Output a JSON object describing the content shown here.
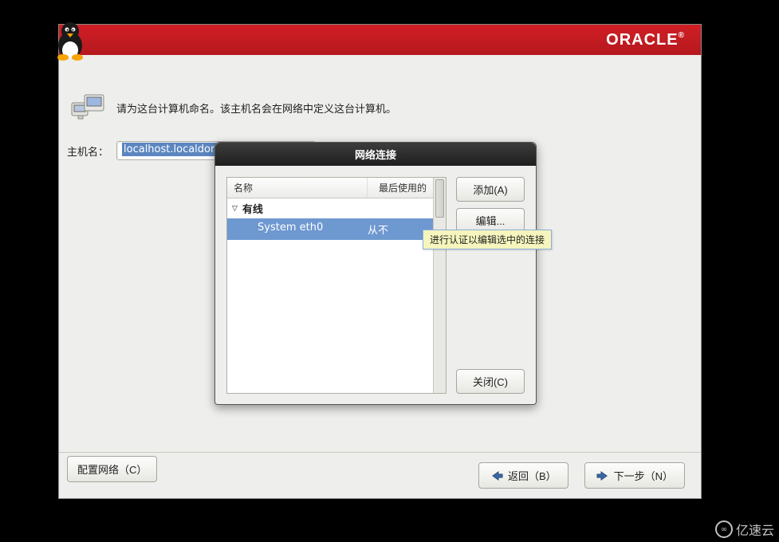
{
  "header": {
    "brand": "ORACLE"
  },
  "instruction": "请为这台计算机命名。该主机名会在网络中定义这台计算机。",
  "hostname": {
    "label": "主机名：",
    "value": "localhost.localdomain"
  },
  "configure_network_label": "配置网络（C）",
  "footer": {
    "back": "返回（B）",
    "next": "下一步（N）"
  },
  "dialog": {
    "title": "网络连接",
    "columns": {
      "name": "名称",
      "last": "最后使用的"
    },
    "group": "有线",
    "row": {
      "name": "System eth0",
      "last": "从不"
    },
    "buttons": {
      "add": "添加(A)",
      "edit": "编辑...",
      "close": "关闭(C)"
    }
  },
  "tooltip": "进行认证以编辑选中的连接",
  "watermark": "亿速云"
}
